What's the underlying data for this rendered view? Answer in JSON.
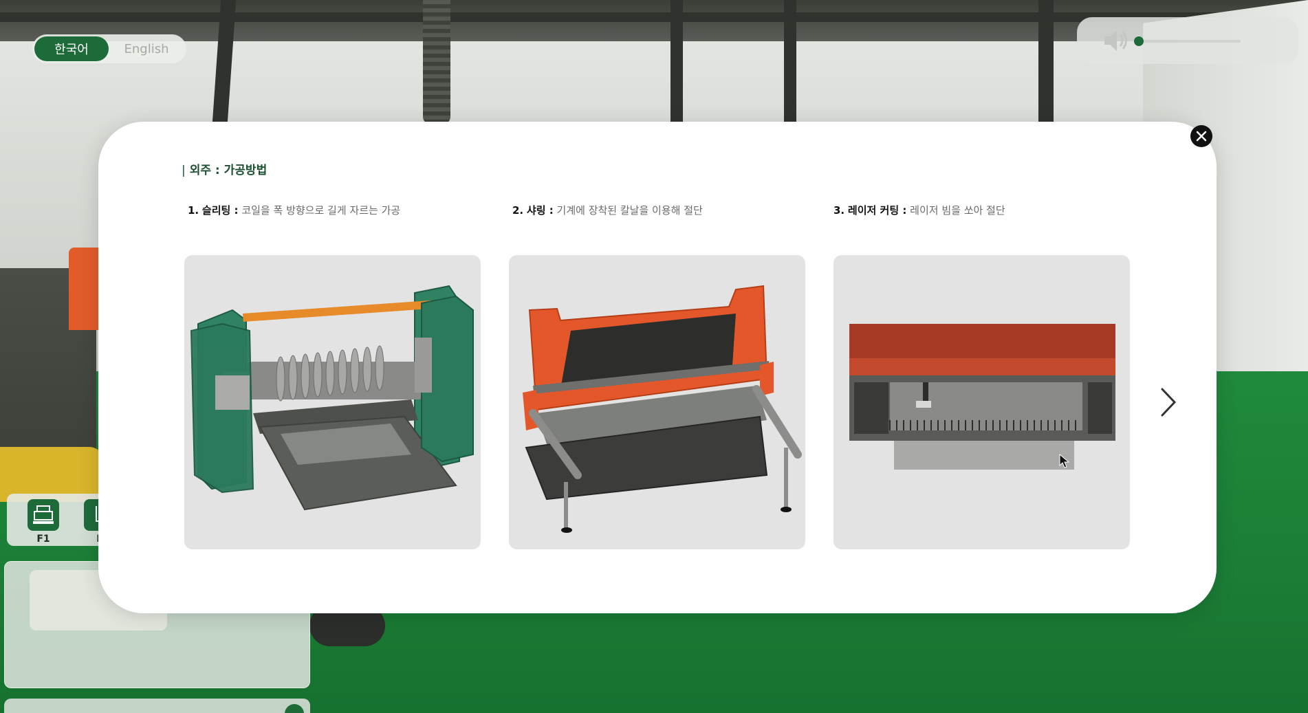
{
  "language": {
    "options": [
      "한국어",
      "English"
    ],
    "selected": "한국어"
  },
  "volume": {
    "level": 0.0,
    "icon": "speaker-icon"
  },
  "floor_buttons": [
    {
      "label": "F1",
      "icon": "machine-icon"
    },
    {
      "label": "F",
      "icon": "tool-icon"
    }
  ],
  "modal": {
    "title": "외주 : 가공방법",
    "items": [
      {
        "number": "1.",
        "name": "슬리팅 :",
        "description": "코일을 폭 방향으로 길게 자르는 가공",
        "image": "slitting-machine"
      },
      {
        "number": "2.",
        "name": "샤링 :",
        "description": "기계에 장착된 칼날을 이용해 절단",
        "image": "shearing-machine"
      },
      {
        "number": "3.",
        "name": "레이저 커팅 :",
        "description": "레이저 빔을 쏘아 절단",
        "image": "laser-cutting-machine"
      }
    ],
    "close_icon": "close-icon",
    "next_icon": "chevron-right-icon"
  },
  "colors": {
    "accent_green": "#1e6b3a",
    "title_green": "#1b4f30",
    "machine_orange": "#e4572a",
    "machine_teal": "#2f8262"
  }
}
